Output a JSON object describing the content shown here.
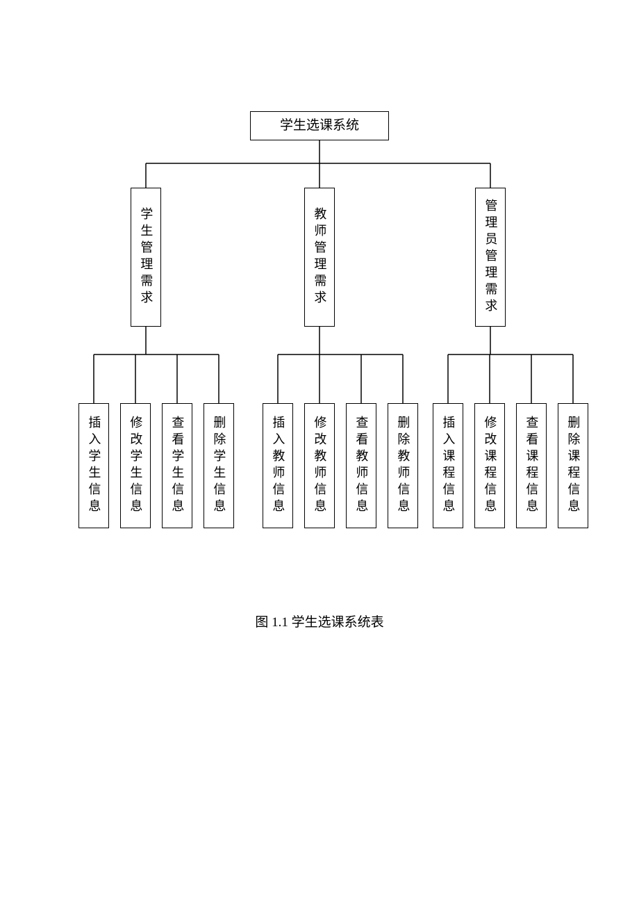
{
  "root": "学生选课系统",
  "mid": [
    "学生管理需求",
    "教师管理需求",
    "管理员管理需求"
  ],
  "leaves": [
    [
      "插入学生信息",
      "修改学生信息",
      "查看学生信息",
      "删除学生信息"
    ],
    [
      "插入教师信息",
      "修改教师信息",
      "查看教师信息",
      "删除教师信息"
    ],
    [
      "插入课程信息",
      "修改课程信息",
      "查看课程信息",
      "删除课程信息"
    ]
  ],
  "caption": "图 1.1 学生选课系统表"
}
